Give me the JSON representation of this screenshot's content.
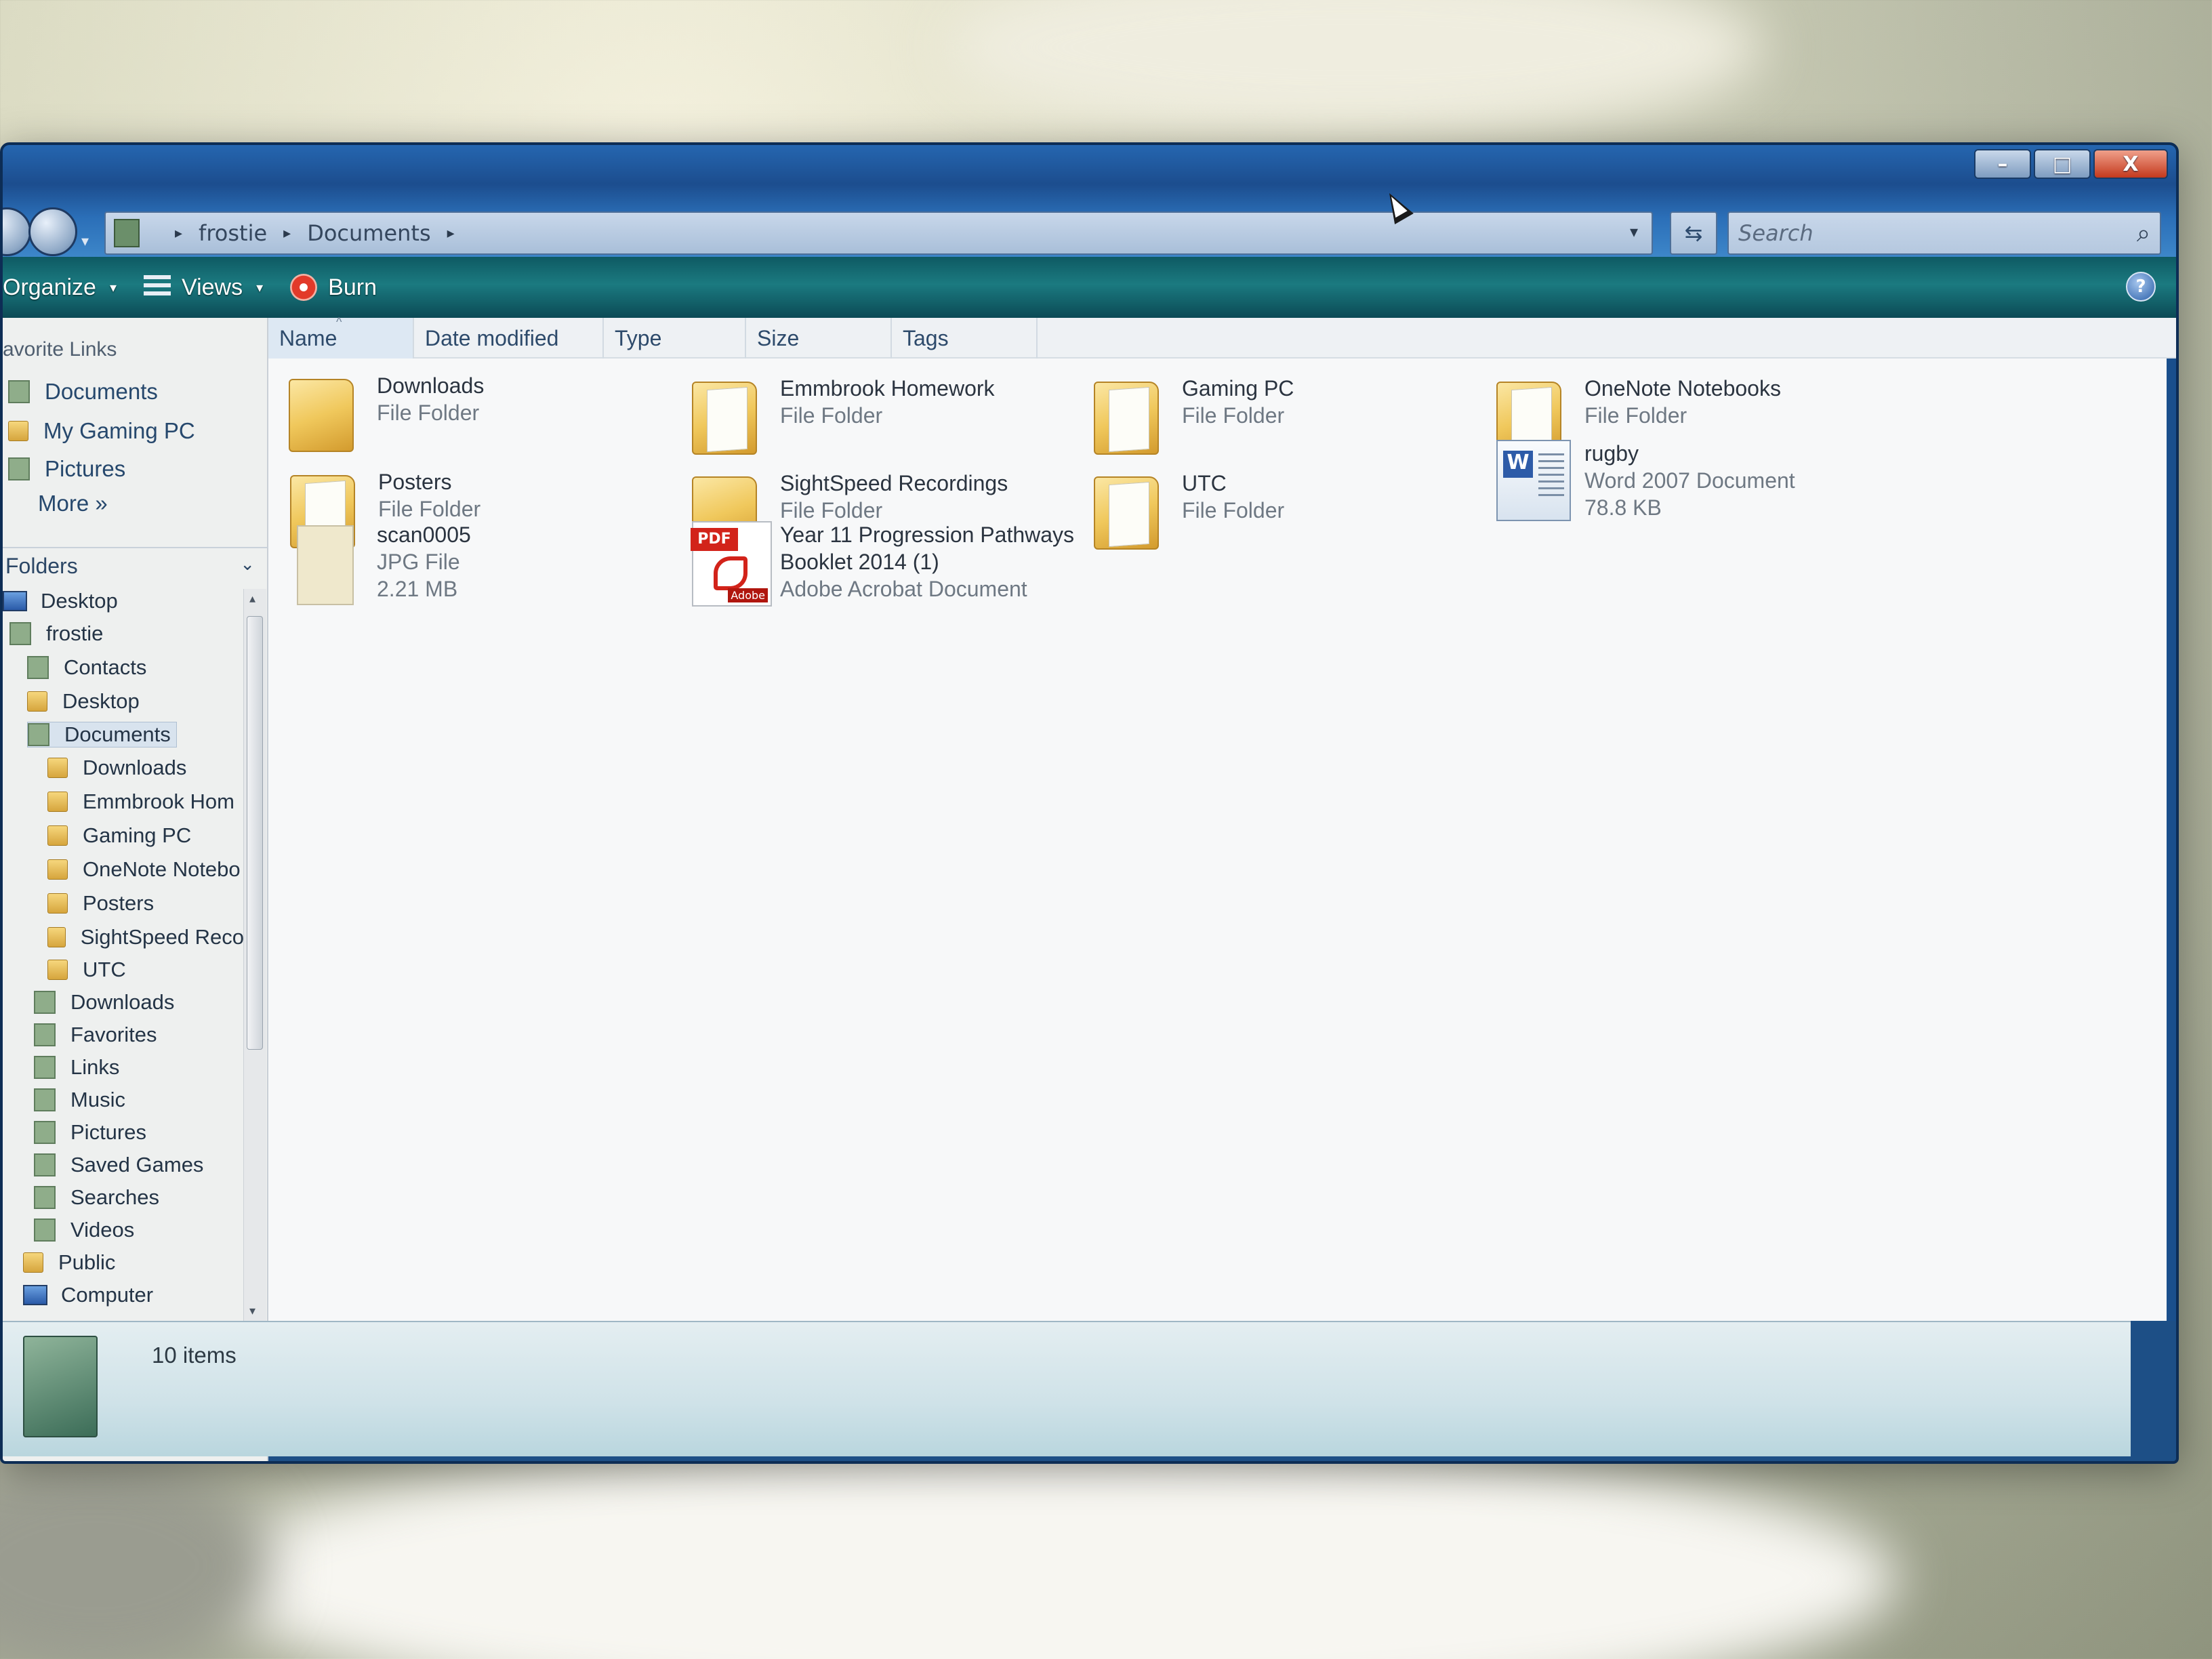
{
  "window": {
    "controls": {
      "minimize": "–",
      "maximize": "□",
      "close": "X"
    }
  },
  "address_bar": {
    "crumbs": [
      "frostie",
      "Documents"
    ],
    "separator": "▸",
    "dropdown": "▾",
    "refresh": "⇆"
  },
  "search": {
    "placeholder": "Search",
    "icon": "⌕"
  },
  "command_bar": {
    "organize": "Organize",
    "views": "Views",
    "burn": "Burn",
    "dropdown": "▾",
    "help": "?"
  },
  "navigation": {
    "favorite_links_header": "avorite Links",
    "favorite_links": [
      "Documents",
      "My Gaming PC",
      "Pictures"
    ],
    "more": "More »",
    "folders_header": "Folders",
    "folders_chevron": "⌄",
    "tree": [
      {
        "label": "Desktop",
        "icon": "desktop-icon"
      },
      {
        "label": "frostie",
        "icon": "user-folder-icon"
      },
      {
        "label": "Contacts",
        "icon": "contacts-icon"
      },
      {
        "label": "Desktop",
        "icon": "folder-icon"
      },
      {
        "label": "Documents",
        "icon": "documents-icon",
        "selected": true
      },
      {
        "label": "Downloads",
        "icon": "folder-icon"
      },
      {
        "label": "Emmbrook Hom",
        "icon": "folder-icon"
      },
      {
        "label": "Gaming PC",
        "icon": "folder-icon"
      },
      {
        "label": "OneNote Notebo",
        "icon": "folder-icon"
      },
      {
        "label": "Posters",
        "icon": "folder-icon"
      },
      {
        "label": "SightSpeed Reco",
        "icon": "folder-icon"
      },
      {
        "label": "UTC",
        "icon": "folder-icon"
      },
      {
        "label": "Downloads",
        "icon": "downloads-icon"
      },
      {
        "label": "Favorites",
        "icon": "favorites-icon"
      },
      {
        "label": "Links",
        "icon": "links-icon"
      },
      {
        "label": "Music",
        "icon": "music-icon"
      },
      {
        "label": "Pictures",
        "icon": "pictures-icon"
      },
      {
        "label": "Saved Games",
        "icon": "saved-games-icon"
      },
      {
        "label": "Searches",
        "icon": "searches-icon"
      },
      {
        "label": "Videos",
        "icon": "videos-icon"
      },
      {
        "label": "Public",
        "icon": "folder-icon"
      },
      {
        "label": "Computer",
        "icon": "computer-icon"
      }
    ],
    "scroll_up": "▴",
    "scroll_down": "▾"
  },
  "columns": [
    "Name",
    "Date modified",
    "Type",
    "Size",
    "Tags"
  ],
  "sort_indicator": "^",
  "items": [
    {
      "name": "Downloads",
      "type": "File Folder",
      "icon": "folder-icon"
    },
    {
      "name": "Emmbrook Homework",
      "type": "File Folder",
      "icon": "folder-icon"
    },
    {
      "name": "Gaming PC",
      "type": "File Folder",
      "icon": "folder-icon"
    },
    {
      "name": "OneNote Notebooks",
      "type": "File Folder",
      "icon": "folder-icon"
    },
    {
      "name": "Posters",
      "type": "File Folder",
      "icon": "folder-icon"
    },
    {
      "name": "SightSpeed Recordings",
      "type": "File Folder",
      "icon": "folder-icon"
    },
    {
      "name": "UTC",
      "type": "File Folder",
      "icon": "folder-icon"
    },
    {
      "name": "rugby",
      "type": "Word 2007 Document",
      "size": "78.8 KB",
      "icon": "word-document-icon"
    },
    {
      "name": "scan0005",
      "type": "JPG File",
      "size": "2.21 MB",
      "icon": "jpg-file-icon"
    },
    {
      "name": "Year 11 Progression Pathways",
      "name_line2": "Booklet 2014 (1)",
      "type": "Adobe Acrobat Document",
      "icon": "pdf-file-icon",
      "icon_tag": "PDF",
      "icon_brand": "Adobe"
    }
  ],
  "status": {
    "item_count": "10 items"
  }
}
